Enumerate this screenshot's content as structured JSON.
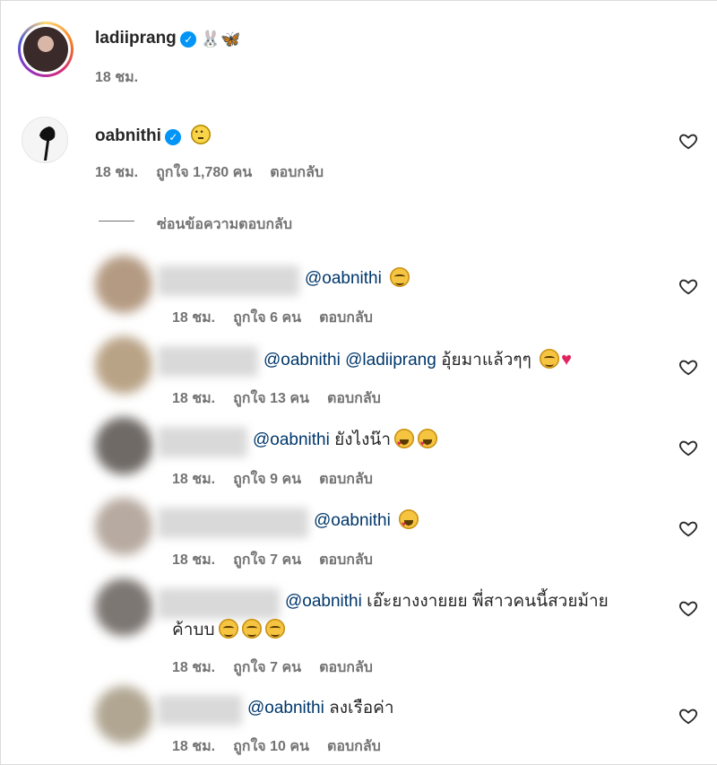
{
  "post": {
    "username": "ladiiprang",
    "time": "18 ชม.",
    "icons": [
      "verified-badge-icon",
      "rabbit-emoji-icon",
      "butterfly-emoji-icon"
    ]
  },
  "comment": {
    "username": "oabnithi",
    "time": "18 ชม.",
    "likes": "ถูกใจ 1,780 คน",
    "reply": "ตอบกลับ",
    "icons": [
      "verified-badge-icon",
      "neutral-face-emoji-icon",
      "heart-icon"
    ]
  },
  "hide_replies": "ซ่อนข้อความตอบกลับ",
  "replies": [
    {
      "mention1": "@oabnithi",
      "text": "",
      "time": "18 ชม.",
      "likes": "ถูกใจ 6 คน",
      "reply": "ตอบกลับ",
      "emojis": [
        "smirk"
      ]
    },
    {
      "mention1": "@oabnithi",
      "mention2": "@ladiiprang",
      "text": "อุ้ยมาแล้วๆๆ",
      "time": "18 ชม.",
      "likes": "ถูกใจ 13 คน",
      "reply": "ตอบกลับ",
      "emojis": [
        "smirk",
        "red-heart"
      ]
    },
    {
      "mention1": "@oabnithi",
      "text": "ยังไงน๊า",
      "time": "18 ชม.",
      "likes": "ถูกใจ 9 คน",
      "reply": "ตอบกลับ",
      "emojis": [
        "heart-eyes",
        "heart-eyes"
      ]
    },
    {
      "mention1": "@oabnithi",
      "text": "",
      "time": "18 ชม.",
      "likes": "ถูกใจ 7 คน",
      "reply": "ตอบกลับ",
      "emojis": [
        "heart-eyes"
      ]
    },
    {
      "mention1": "@oabnithi",
      "text": "เอ๊ะยางงายยย พี่สาวคนนี้สวยม้าย",
      "text2": "ค้าบบ",
      "time": "18 ชม.",
      "likes": "ถูกใจ 7 คน",
      "reply": "ตอบกลับ",
      "emojis": [
        "smirk",
        "smirk",
        "smirk"
      ]
    },
    {
      "mention1": "@oabnithi",
      "text": "ลงเรือค่า",
      "time": "18 ชม.",
      "likes": "ถูกใจ 10 คน",
      "reply": "ตอบกลับ",
      "emojis": []
    }
  ],
  "colors": {
    "verified": "#0095f6",
    "mention": "#00376b",
    "meta": "#737373",
    "text": "#262626"
  }
}
